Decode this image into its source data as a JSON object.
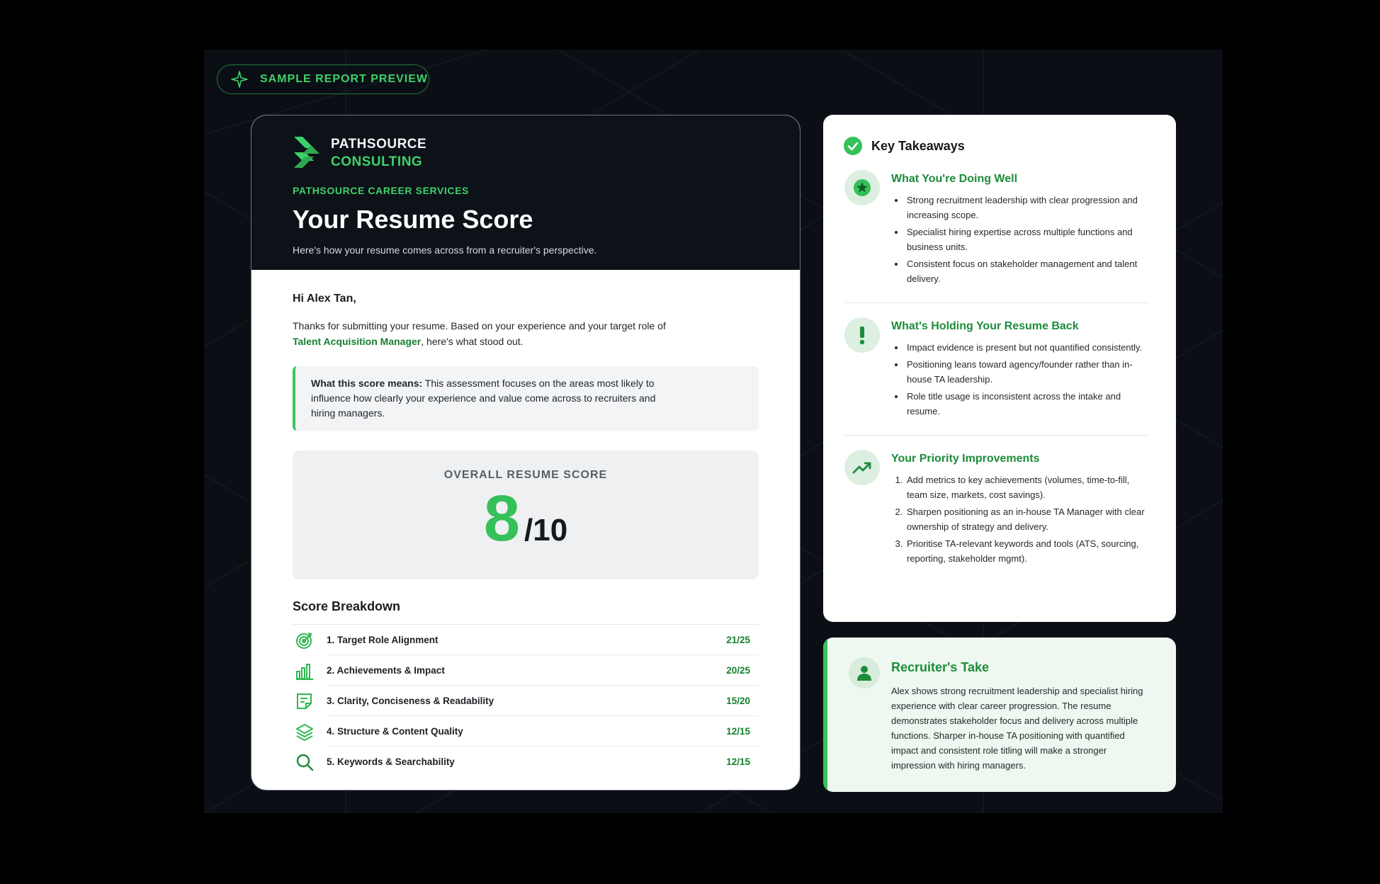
{
  "badge": {
    "label": "SAMPLE REPORT PREVIEW",
    "icon": "sparkle-icon"
  },
  "report": {
    "logo_line1": "PATHSOURCE",
    "logo_line2": "CONSULTING",
    "eyebrow": "PATHSOURCE CAREER SERVICES",
    "title": "Your Resume Score",
    "subtitle": "Here's how your resume comes across from a recruiter's perspective.",
    "greeting": "Hi Alex Tan,",
    "intro_before": "Thanks for submitting your resume. Based on your experience and your target role of",
    "intro_role": "Talent Acquisition Manager",
    "intro_after": ", here's what stood out.",
    "callout_label": "What this score means:",
    "callout_text": " This assessment focuses on the areas most likely to influence how clearly your experience and value come across to recruiters and hiring managers.",
    "score_label": "OVERALL RESUME SCORE",
    "score_value": "8",
    "score_max": "/10",
    "breakdown_title": "Score Breakdown",
    "breakdown": [
      {
        "label": "1. Target Role Alignment",
        "score": "21/25",
        "icon": "target-icon"
      },
      {
        "label": "2. Achievements & Impact",
        "score": "20/25",
        "icon": "bar-chart-icon"
      },
      {
        "label": "3. Clarity, Conciseness & Readability",
        "score": "15/20",
        "icon": "document-icon"
      },
      {
        "label": "4. Structure & Content Quality",
        "score": "12/15",
        "icon": "layers-icon"
      },
      {
        "label": "5. Keywords & Searchability",
        "score": "12/15",
        "icon": "search-icon"
      }
    ]
  },
  "takeaways": {
    "title": "Key Takeaways",
    "sections": [
      {
        "title": "What You're Doing Well",
        "icon": "star-icon",
        "items": [
          "Strong recruitment leadership with clear progression and increasing scope.",
          "Specialist hiring expertise across multiple functions and business units.",
          "Consistent focus on stakeholder management and talent delivery."
        ]
      },
      {
        "title": "What's Holding Your Resume Back",
        "icon": "exclamation-icon",
        "items": [
          "Impact evidence is present but not quantified consistently.",
          "Positioning leans toward agency/founder rather than in-house TA leadership.",
          "Role title usage is inconsistent across the intake and resume."
        ]
      },
      {
        "title": "Your Priority Improvements",
        "icon": "trend-up-icon",
        "items": [
          "Add metrics to key achievements (volumes, time-to-fill, team size, markets, cost savings).",
          "Sharpen positioning as an in-house TA Manager with clear ownership of strategy and delivery.",
          "Prioritise TA-relevant keywords and tools (ATS, sourcing, reporting, stakeholder mgmt)."
        ]
      }
    ]
  },
  "recruiter": {
    "title": "Recruiter's Take",
    "icon": "person-icon",
    "text": "Alex shows strong recruitment leadership and specialist hiring experience with clear career progression. The resume demonstrates stakeholder focus and delivery across multiple functions. Sharper in-house TA positioning with quantified impact and consistent role titling will make a stronger impression with hiring managers."
  },
  "colors": {
    "accent": "#35c05a",
    "accent_dark": "#16802f",
    "background": "#0b0f15"
  }
}
